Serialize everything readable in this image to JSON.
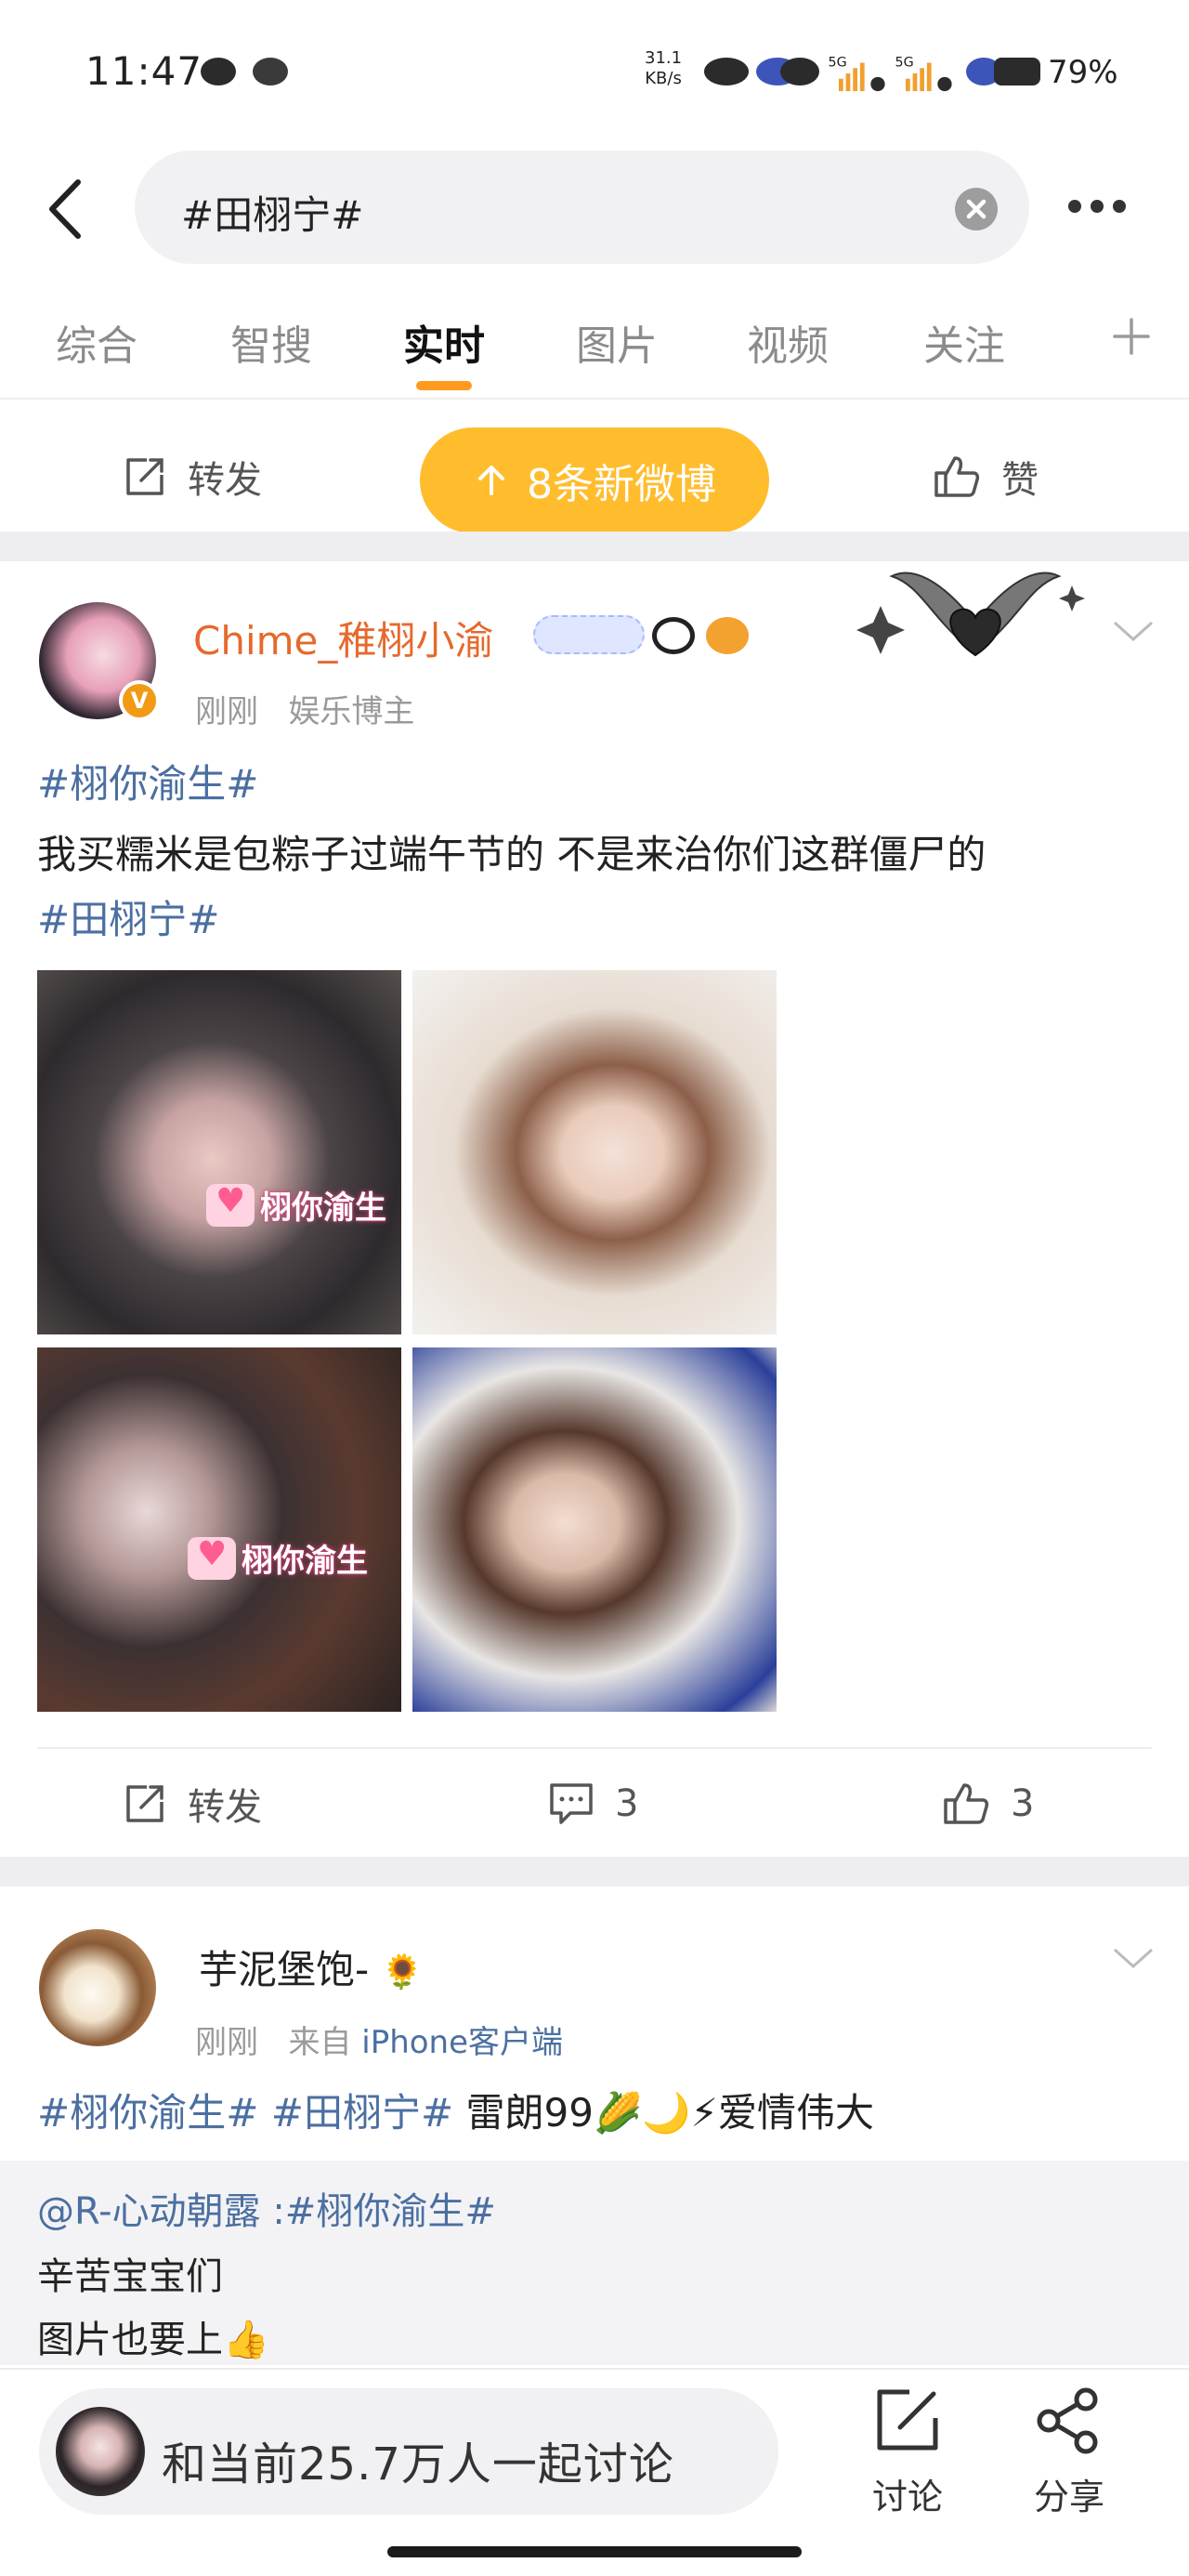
{
  "status_bar": {
    "time": "11:47",
    "net_speed_value": "31.1",
    "net_speed_unit": "KB/s",
    "sim1": "5G",
    "sim2": "5G",
    "battery": "79%"
  },
  "header": {
    "query": "#田栩宁#",
    "back_icon": "chevron-left-icon",
    "clear_icon": "clear-circle-icon",
    "more_icon": "more-dots-icon"
  },
  "tabs": [
    {
      "label": "综合"
    },
    {
      "label": "智搜"
    },
    {
      "label": "实时",
      "active": true
    },
    {
      "label": "图片"
    },
    {
      "label": "视频"
    },
    {
      "label": "关注"
    }
  ],
  "prev_post_actions": {
    "repost": "转发",
    "like": "赞"
  },
  "new_posts_pill": "8条新微博",
  "post1": {
    "username": "Chime_稚栩小渝",
    "time": "刚刚",
    "tag": "娱乐博主",
    "topic": "#栩你渝生#",
    "text": "我买糯米是包粽子过端午节的 不是来治你们这群僵尸的",
    "hashtag": "#田栩宁#",
    "watermark": "栩你渝生",
    "repost": "转发",
    "comments": "3",
    "likes": "3"
  },
  "post2": {
    "username": "芋泥堡饱-",
    "username_emoji": "🌻",
    "time": "刚刚",
    "source_prefix": "来自",
    "source": "iPhone客户端",
    "hashtag1": "#栩你渝生#",
    "hashtag2": "#田栩宁#",
    "text": "雷朗99🌽🌙⚡爱情伟大",
    "quote_user": "@R-心动朝露",
    "quote_topic": ":#栩你渝生#",
    "quote_line1": "辛苦宝宝们",
    "quote_line2": "图片也要上👍"
  },
  "bottom_bar": {
    "discuss_prompt": "和当前25.7万人一起讨论",
    "discuss_label": "讨论",
    "share_label": "分享"
  },
  "colors": {
    "accent_orange": "#ffbd2e",
    "tab_underline": "#ff9a1e",
    "username_orange": "#e6692c",
    "hashtag_blue": "#4b6fa1",
    "verified_badge": "#f29a14"
  }
}
